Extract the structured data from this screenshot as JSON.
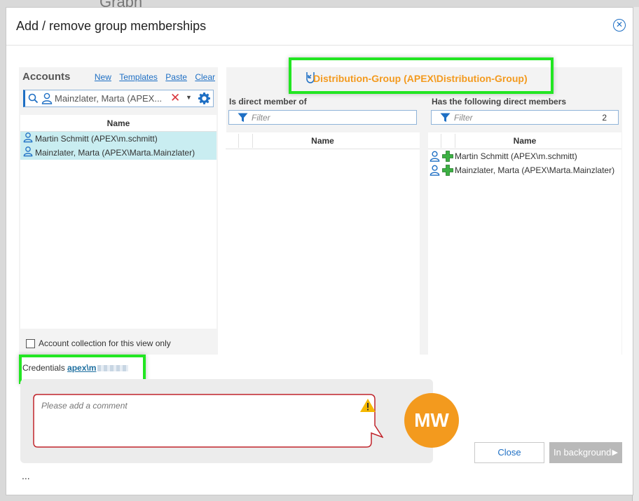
{
  "background": {
    "title": "Graph"
  },
  "dialog": {
    "title": "Add / remove group memberships"
  },
  "accounts": {
    "title": "Accounts",
    "links": [
      "New",
      "Templates",
      "Paste",
      "Clear"
    ],
    "search_value": "Mainzlater, Marta (APEX...",
    "column_header": "Name",
    "rows": [
      "Martin Schmitt (APEX\\m.schmitt)",
      "Mainzlater, Marta (APEX\\Marta.Mainzlater)"
    ],
    "collection_checkbox_label": "Account collection for this view only",
    "collection_checked": false
  },
  "group": {
    "name": "Distribution-Group (APEX\\Distribution-Group)",
    "color": "#f39a1e"
  },
  "member_of": {
    "title": "Is direct member of",
    "filter_placeholder": "Filter",
    "column_header": "Name",
    "rows": []
  },
  "members": {
    "title": "Has the following direct members",
    "filter_placeholder": "Filter",
    "count": "2",
    "column_header": "Name",
    "rows": [
      "Martin Schmitt (APEX\\m.schmitt)",
      "Mainzlater, Marta (APEX\\Marta.Mainzlater)"
    ]
  },
  "credentials": {
    "label": "Credentials",
    "user": "apex\\m"
  },
  "comment": {
    "placeholder": "Please add a comment"
  },
  "avatar": {
    "initials": "MW",
    "color": "#f39a1e"
  },
  "buttons": {
    "close": "Close",
    "background": "In background"
  },
  "footer": {
    "ellipsis": "..."
  },
  "highlight_color": "#22e622",
  "accent_color": "#1e6fc4"
}
